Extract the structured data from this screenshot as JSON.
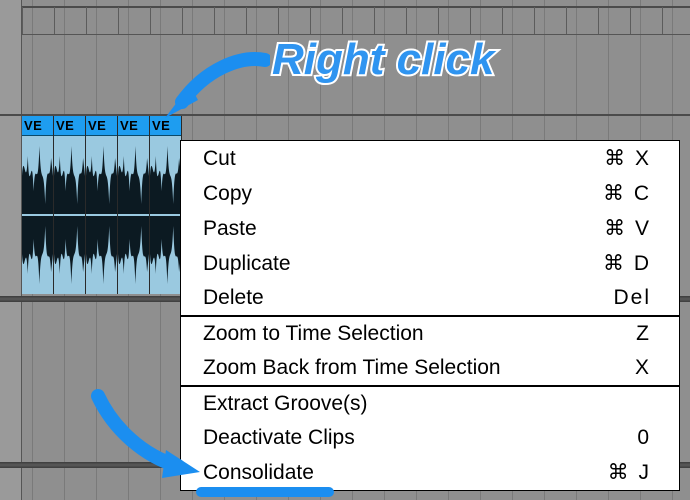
{
  "annotation": {
    "rightClick": "Right click"
  },
  "clips": [
    {
      "label": "VE"
    },
    {
      "label": "VE"
    },
    {
      "label": "VE"
    },
    {
      "label": "VE"
    },
    {
      "label": "VE"
    }
  ],
  "menu": {
    "sections": [
      [
        {
          "label": "Cut",
          "shortcut": "⌘ X"
        },
        {
          "label": "Copy",
          "shortcut": "⌘ C"
        },
        {
          "label": "Paste",
          "shortcut": "⌘ V"
        },
        {
          "label": "Duplicate",
          "shortcut": "⌘ D"
        },
        {
          "label": "Delete",
          "shortcut": "Del"
        }
      ],
      [
        {
          "label": "Zoom to Time Selection",
          "shortcut": "Z"
        },
        {
          "label": "Zoom Back from Time Selection",
          "shortcut": "X"
        }
      ],
      [
        {
          "label": "Extract Groove(s)",
          "shortcut": ""
        },
        {
          "label": "Deactivate Clips",
          "shortcut": "0"
        },
        {
          "label": "Consolidate",
          "shortcut": "⌘ J"
        }
      ]
    ]
  }
}
